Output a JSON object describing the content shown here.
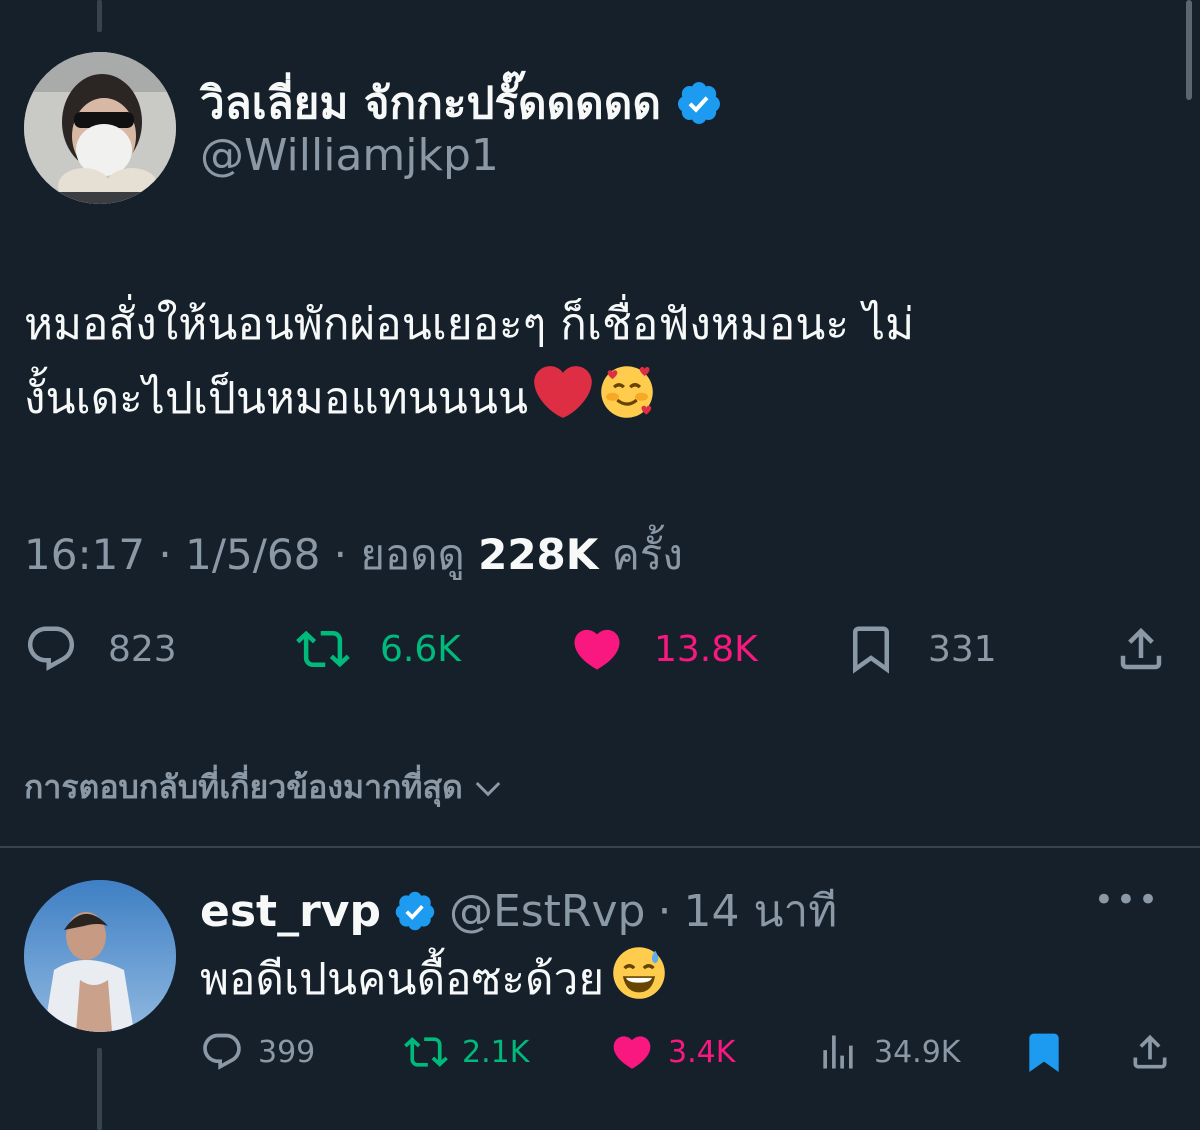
{
  "tweet": {
    "display_name": "วิลเลี่ยม จักกะปรั๊ดดดดด",
    "handle": "@Williamjkp1",
    "text": "หมอสั่งให้นอนพักผ่อนเยอะๆ ก็เชื่อฟังหมอนะ ไม่\nงั้นเดะไปเป็นหมอแทนนนน",
    "time": "16:17",
    "date": "1/5/68",
    "views_label": "ยอดดู",
    "views": "228K",
    "views_unit": "ครั้ง",
    "stats": {
      "replies": "823",
      "retweets": "6.6K",
      "likes": "13.8K",
      "bookmarks": "331"
    }
  },
  "replies_sort_label": "การตอบกลับที่เกี่ยวข้องมากที่สุด",
  "reply": {
    "display_name": "est_rvp",
    "handle": "@EstRvp",
    "time": "14 นาที",
    "text": "พอดีเปนคนดื้อซะด้วย",
    "stats": {
      "replies": "399",
      "retweets": "2.1K",
      "likes": "3.4K",
      "views": "34.9K"
    }
  },
  "colors": {
    "background": "#15202b",
    "secondary_text": "#8b98a5",
    "retweet_green": "#00ba7c",
    "like_pink": "#f91880",
    "verified_blue": "#1d9bf0"
  },
  "icons": [
    "verified-badge-icon",
    "reply-icon",
    "retweet-icon",
    "like-heart-icon",
    "bookmark-icon",
    "share-icon",
    "views-icon",
    "chevron-down-icon",
    "more-icon",
    "red-heart-emoji",
    "smiling-face-with-hearts-emoji",
    "grinning-sweat-emoji"
  ]
}
